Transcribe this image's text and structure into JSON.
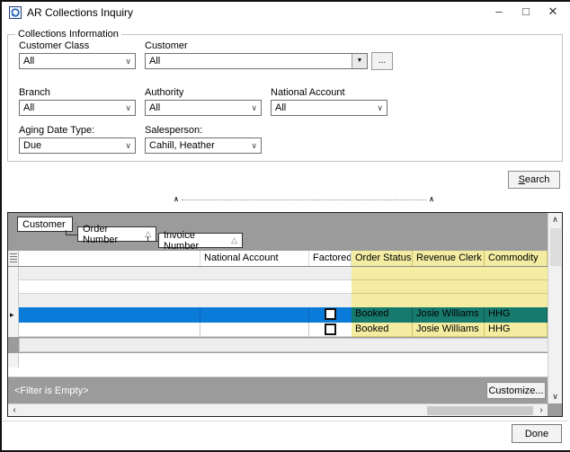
{
  "window": {
    "title": "AR Collections Inquiry"
  },
  "icons": {
    "minimize": "–",
    "maximize": "□",
    "close": "✕",
    "caret": "∧",
    "up": "∧",
    "down": "∨",
    "left": "‹",
    "right": "›",
    "dropdown_chevron": "∨",
    "dropdown_classic": "▼",
    "row_arrow": "▸"
  },
  "filters": {
    "group_title": "Collections Information",
    "customer_class": {
      "label": "Customer Class",
      "value": "All"
    },
    "customer": {
      "label": "Customer",
      "value": "All",
      "browse": "..."
    },
    "branch": {
      "label": "Branch",
      "value": "All"
    },
    "authority": {
      "label": "Authority",
      "value": "All"
    },
    "national_account": {
      "label": "National Account",
      "value": "All"
    },
    "aging_date_type": {
      "label": "Aging Date Type:",
      "value": "Due"
    },
    "salesperson": {
      "label": "Salesperson:",
      "value": "Cahill, Heather"
    },
    "search_label": "Search"
  },
  "grid": {
    "group_by": [
      {
        "label": "Customer"
      },
      {
        "label": "Order Number"
      },
      {
        "label": "Invoice Number"
      }
    ],
    "sort_icon": "△",
    "columns": {
      "national_account": "National Account",
      "factored": "Factored",
      "order_status": "Order Status",
      "revenue_clerk": "Revenue Clerk",
      "commodity": "Commodity"
    },
    "rows": [
      {
        "selected": true,
        "factored_checked": false,
        "order_status": "Booked",
        "revenue_clerk": "Josie Williams",
        "commodity": "HHG"
      },
      {
        "selected": false,
        "factored_checked": false,
        "order_status": "Booked",
        "revenue_clerk": "Josie Williams",
        "commodity": "HHG"
      }
    ],
    "filter_status": "<Filter is Empty>",
    "customize_label": "Customize..."
  },
  "footer": {
    "done_label": "Done"
  },
  "colors": {
    "selection_blue": "#0b7bd9",
    "highlight_green": "#177a6e",
    "highlight_yellow": "#f3eca2",
    "panel_gray": "#9b9b9b"
  }
}
